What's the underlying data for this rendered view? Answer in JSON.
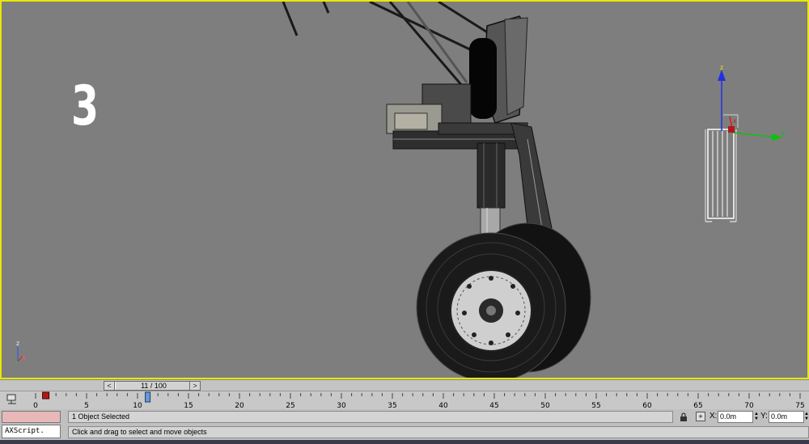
{
  "viewport": {
    "label": "3",
    "gizmo_axes": {
      "x": "x",
      "y": "y",
      "z": "z"
    },
    "corner_axes": {
      "x": "x",
      "z": "z"
    },
    "colors": {
      "background": "#7e7e7e",
      "active_border": "#e8e800"
    }
  },
  "time_slider": {
    "prev_label": "<",
    "next_label": ">",
    "value_text": "11 / 100"
  },
  "trackbar": {
    "icon": "track-view-icon",
    "ticks": [
      "0",
      "5",
      "10",
      "15",
      "20",
      "25",
      "30",
      "35",
      "40",
      "45",
      "50",
      "55",
      "60",
      "65",
      "70",
      "75"
    ],
    "key_frame": 1,
    "current_frame": 11
  },
  "maxscript": {
    "listener_text": "",
    "input_text": "AXScript."
  },
  "status": {
    "selection_text": "1 Object Selected",
    "prompt_text": "Click and drag to select and move objects",
    "lock_icon": "lock-icon",
    "abs_mode_icon": "absolute-mode-icon",
    "x_label": "X:",
    "x_value": "0.0m",
    "y_label": "Y:",
    "y_value": "0.0m"
  }
}
